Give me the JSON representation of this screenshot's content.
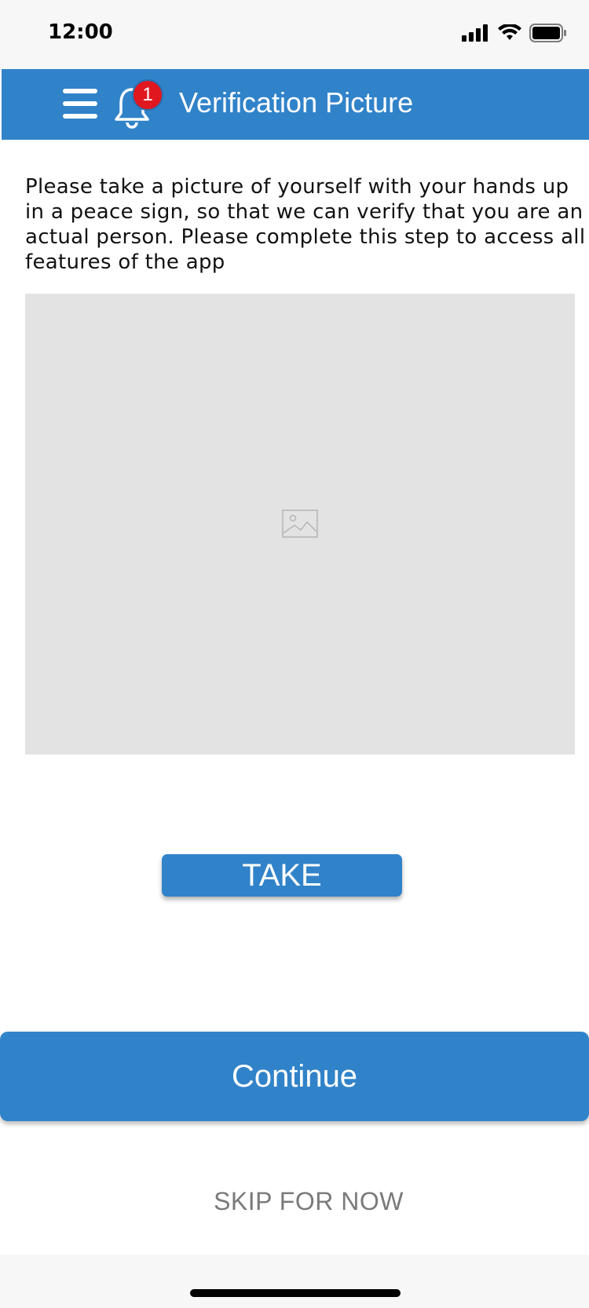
{
  "status_bar": {
    "time": "12:00",
    "icons": [
      "signal-icon",
      "wifi-icon",
      "battery-icon"
    ]
  },
  "header": {
    "title": "Verification Picture",
    "notification_count": "1",
    "menu_icon": "hamburger-menu-icon",
    "bell_icon": "bell-icon"
  },
  "main": {
    "instructions": "Please take a picture of yourself with your hands up in a peace sign, so that we can verify that you are an actual person. Please complete this step to access all features of the app",
    "photo_placeholder_icon": "image-placeholder-icon",
    "take_label": "TAKE"
  },
  "footer": {
    "continue_label": "Continue",
    "skip_label": "SKIP FOR NOW"
  },
  "colors": {
    "primary": "#3183c9",
    "badge": "#e0171f",
    "placeholder_bg": "#e3e3e3",
    "skip_text": "#7a7a7a"
  }
}
